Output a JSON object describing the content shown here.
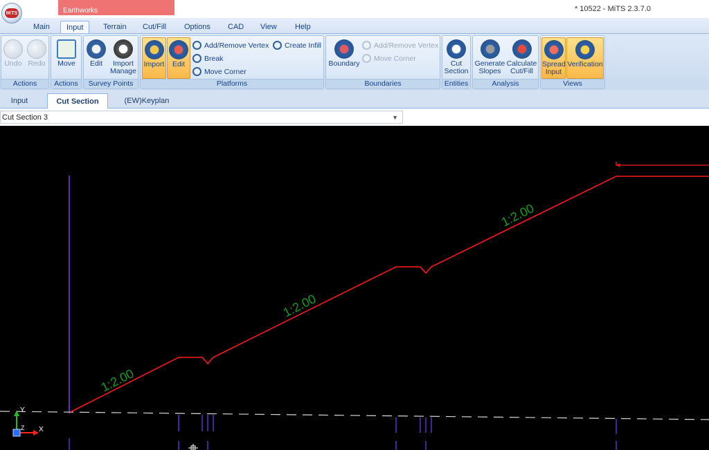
{
  "window": {
    "title": "* 10522 - MiTS 2.3.7.0",
    "context_tab": "Earthworks",
    "logo_text": "MiTS"
  },
  "ribbon_tabs": [
    "Main",
    "Input",
    "Terrain",
    "Cut/Fill",
    "Options",
    "CAD",
    "View",
    "Help"
  ],
  "active_ribbon_tab": "Input",
  "groups": {
    "actions1": {
      "label": "Actions",
      "undo": "Undo",
      "redo": "Redo"
    },
    "actions2": {
      "label": "Actions",
      "move": "Move"
    },
    "survey_points": {
      "label": "Survey Points",
      "edit": "Edit",
      "import_manage_1": "Import",
      "import_manage_2": "Manage"
    },
    "platforms": {
      "label": "Platforms",
      "import": "Import",
      "edit": "Edit",
      "add_remove_vertex": "Add/Remove Vertex",
      "break": "Break",
      "move_corner": "Move Corner",
      "create_infill": "Create Infill"
    },
    "boundaries": {
      "label": "Boundaries",
      "boundary": "Boundary",
      "add_remove_vertex": "Add/Remove Vertex",
      "move_corner": "Move Corner"
    },
    "entities": {
      "label": "Entities",
      "cut_1": "Cut",
      "cut_2": "Section"
    },
    "analysis": {
      "label": "Analysis",
      "gen_1": "Generate",
      "gen_2": "Slopes",
      "calc_1": "Calculate",
      "calc_2": "Cut/Fill"
    },
    "views": {
      "label": "Views",
      "spread_1": "Spread",
      "spread_2": "Input",
      "verification": "Verification"
    }
  },
  "doc_tabs": [
    "Input",
    "Cut Section",
    "(EW)Keyplan"
  ],
  "active_doc_tab": "Cut Section",
  "section_selector": {
    "value": "Cut Section 3"
  },
  "canvas": {
    "slope_labels": [
      "1:2.00",
      "1:2.00",
      "1:2.00"
    ],
    "axis_labels": {
      "y": "Y",
      "x": "X",
      "z": "Z"
    },
    "colors": {
      "profile": "#ff1a1a",
      "ground": "#d8d8d8",
      "slope_text": "#1a9a1a",
      "vertical": "#7a3cff"
    }
  }
}
